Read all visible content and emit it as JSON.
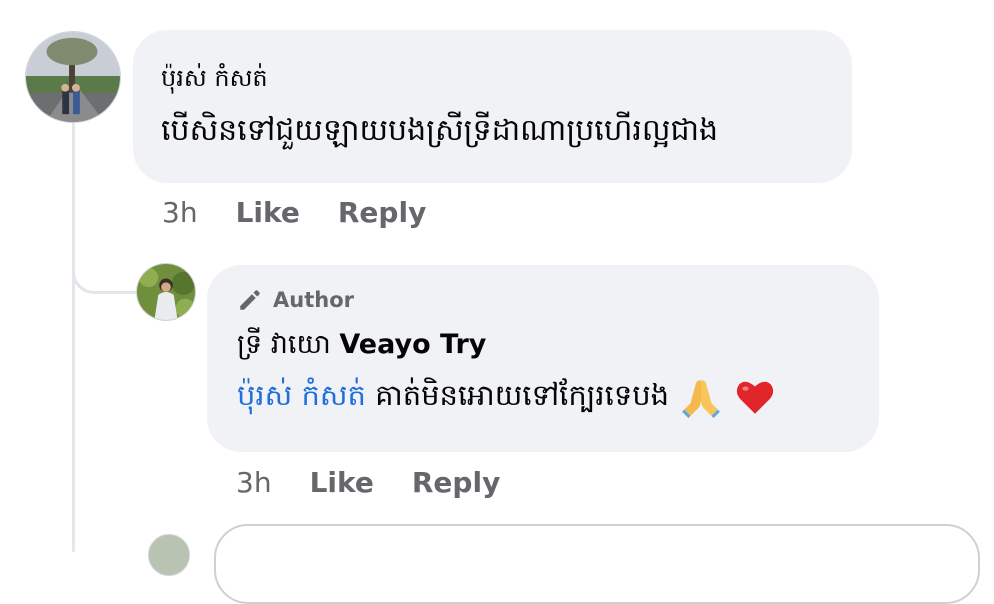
{
  "comment": {
    "commenter_name": "ប៉ុរស់ កំសត់",
    "text": "បើសិនទៅជួយឡាយបងស្រីទ្រីដាណាប្រហើរល្អជាង",
    "time": "3h",
    "like_label": "Like",
    "reply_label": "Reply"
  },
  "reply": {
    "badge_label": "Author",
    "name_khmer": "ទ្រី វាយោ",
    "name_latin": "Veayo Try",
    "mention": "ប៉ុរស់ កំសត់",
    "text": "គាត់មិនអោយទៅក្បែរទេបង",
    "emojis": [
      "folded-hands-icon",
      "red-heart-icon"
    ],
    "time": "3h",
    "like_label": "Like",
    "reply_label": "Reply"
  },
  "colors": {
    "bubble": "#f0f2f5",
    "secondary_text": "#65676b",
    "mention": "#216fdb"
  }
}
